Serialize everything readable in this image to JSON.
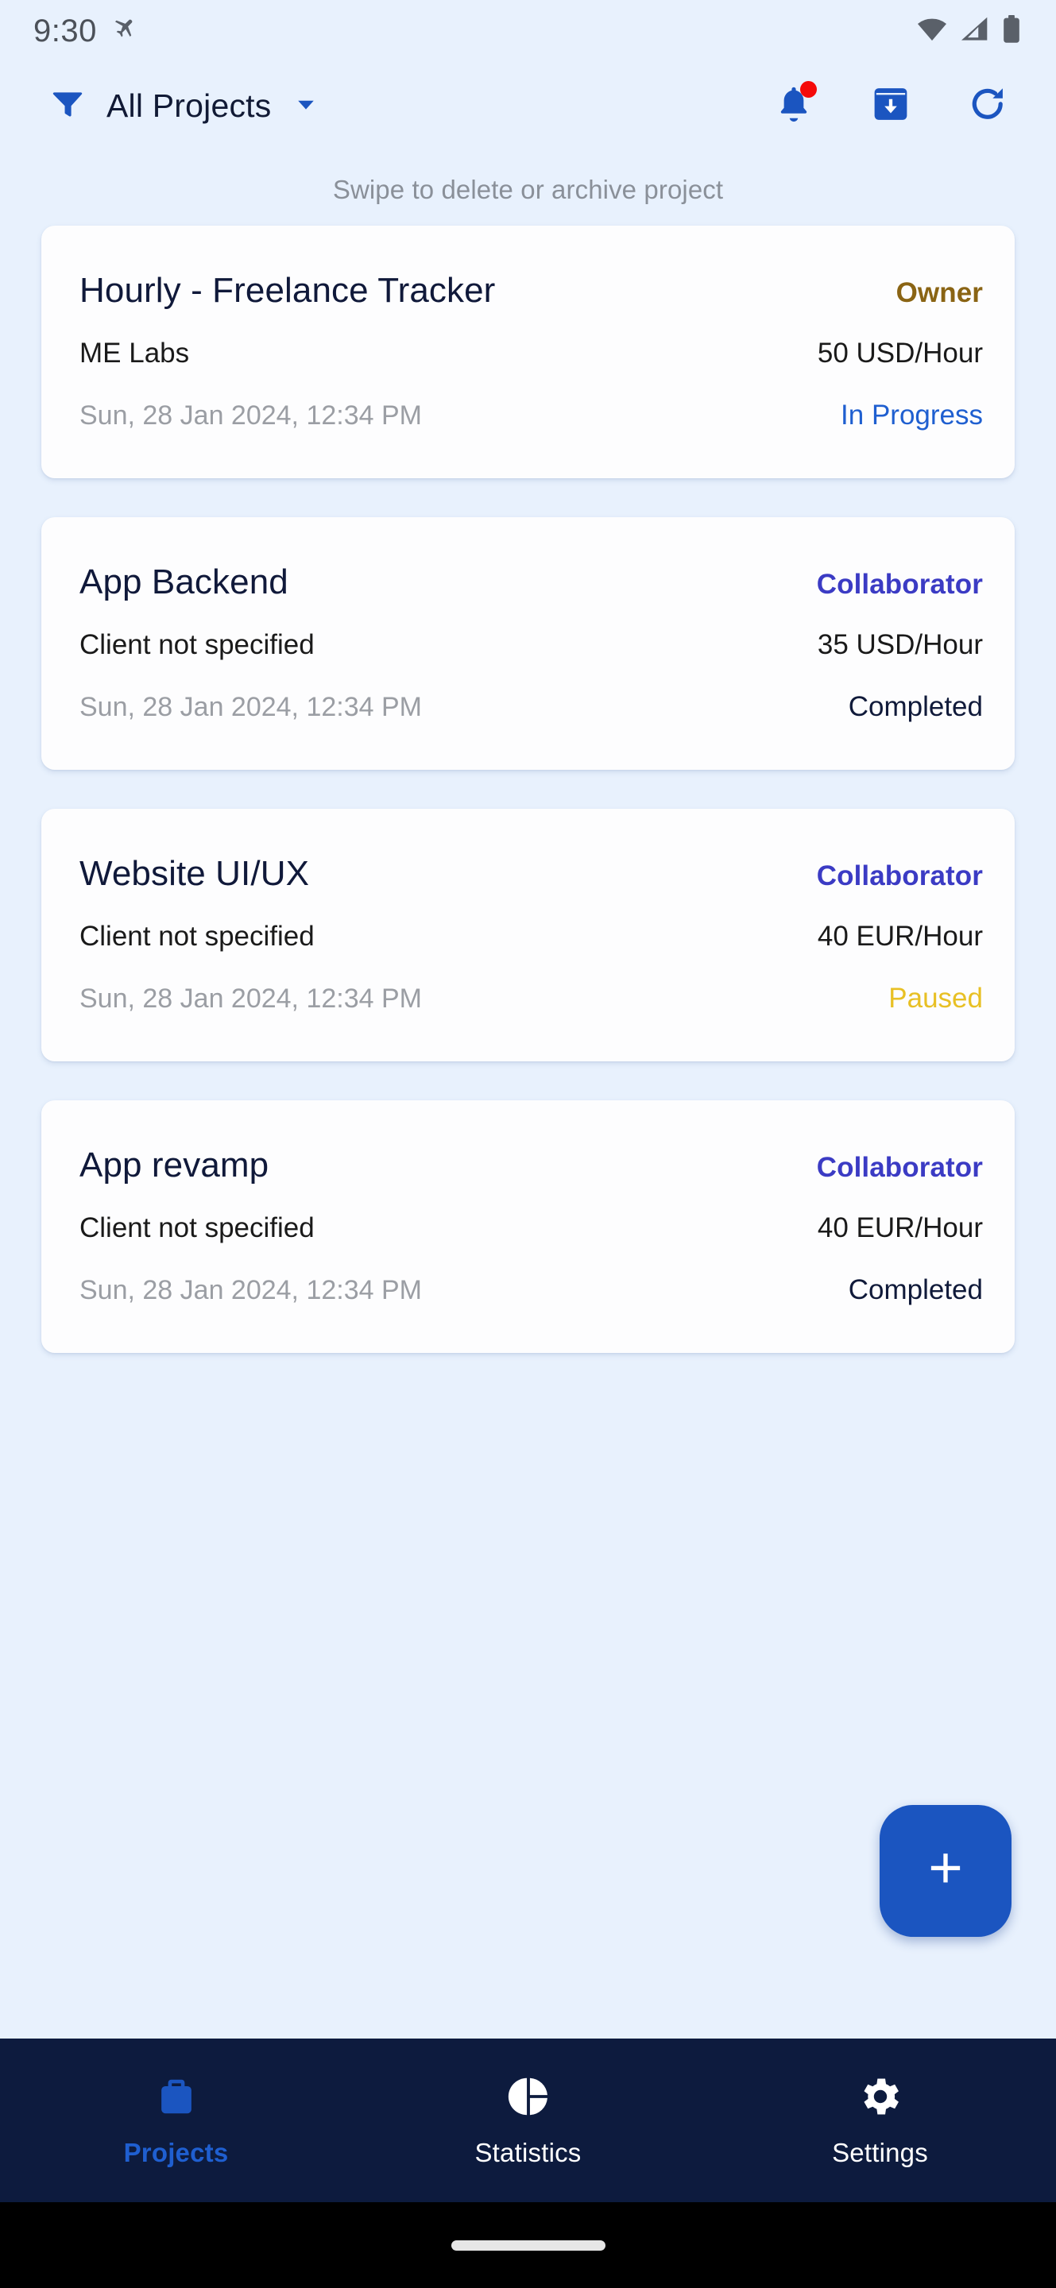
{
  "status_bar": {
    "time": "9:30",
    "icons": [
      "airplane-mode-icon",
      "wifi-icon",
      "cellular-signal-icon",
      "battery-icon"
    ]
  },
  "app_bar": {
    "filter_icon": "filter-funnel-icon",
    "filter_label": "All Projects",
    "dropdown_icon": "chevron-down-icon",
    "actions": [
      {
        "name": "notifications-icon",
        "has_badge": true,
        "badge_color": "#f50a0a"
      },
      {
        "name": "archive-download-icon",
        "has_badge": false
      },
      {
        "name": "refresh-icon",
        "has_badge": false
      }
    ]
  },
  "hint": {
    "text": "Swipe to delete or archive project"
  },
  "projects": [
    {
      "title": "Hourly - Freelance Tracker",
      "role": "Owner",
      "role_type": "owner",
      "client": "ME Labs",
      "rate": "50 USD/Hour",
      "date": "Sun, 28 Jan 2024, 12:34 PM",
      "status": "In Progress",
      "status_type": "inprogress"
    },
    {
      "title": "App Backend",
      "role": "Collaborator",
      "role_type": "collab",
      "client": "Client not specified",
      "rate": "35 USD/Hour",
      "date": "Sun, 28 Jan 2024, 12:34 PM",
      "status": "Completed",
      "status_type": "completed"
    },
    {
      "title": "Website UI/UX",
      "role": "Collaborator",
      "role_type": "collab",
      "client": "Client not specified",
      "rate": "40 EUR/Hour",
      "date": "Sun, 28 Jan 2024, 12:34 PM",
      "status": "Paused",
      "status_type": "paused"
    },
    {
      "title": "App revamp",
      "role": "Collaborator",
      "role_type": "collab",
      "client": "Client not specified",
      "rate": "40 EUR/Hour",
      "date": "Sun, 28 Jan 2024, 12:34 PM",
      "status": "Completed",
      "status_type": "completed"
    }
  ],
  "fab": {
    "icon": "plus-icon",
    "color": "#1b55c0"
  },
  "bottom_nav": {
    "items": [
      {
        "label": "Projects",
        "icon": "briefcase-icon",
        "active": true
      },
      {
        "label": "Statistics",
        "icon": "pie-chart-icon",
        "active": false
      },
      {
        "label": "Settings",
        "icon": "gear-icon",
        "active": false
      }
    ]
  },
  "colors": {
    "background": "#e8f1fd",
    "card": "#fdfdfe",
    "primary_blue": "#1b55c0",
    "nav_background": "#0d1b3e",
    "owner_gold": "#8a6414",
    "collaborator_indigo": "#3b3bc4",
    "status_inprogress": "#1f5fd0",
    "status_completed": "#101a3a",
    "status_paused": "#e8c024",
    "badge_red": "#f50a0a"
  }
}
